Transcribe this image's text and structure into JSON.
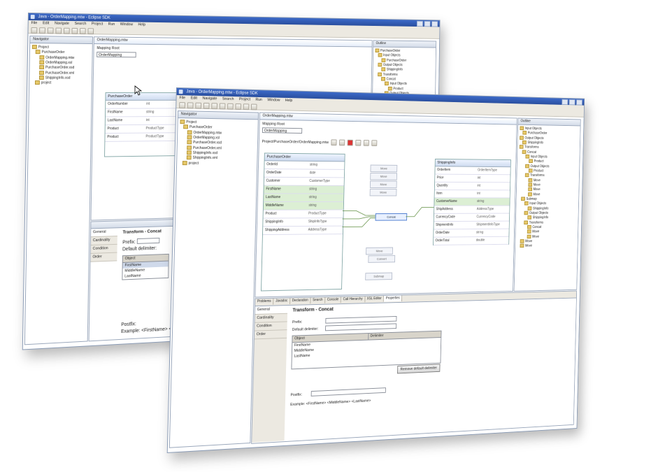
{
  "back_window": {
    "title": "Java - OrderMapping.mtw - Eclipse SDK",
    "menu": [
      "File",
      "Edit",
      "Navigate",
      "Search",
      "Project",
      "Run",
      "Window",
      "Help"
    ],
    "navigator_tab": "Navigator",
    "editor_tab": "OrderMapping.mtw",
    "outline_tab": "Outline",
    "mapping_root_label": "Mapping Root",
    "mapping_root_value": "OrderMapping",
    "tree": [
      {
        "level": 0,
        "label": "Project"
      },
      {
        "level": 1,
        "label": "PurchaseOrder"
      },
      {
        "level": 2,
        "label": "OrderMapping.mtw"
      },
      {
        "level": 2,
        "label": "OrderMapping.xsl"
      },
      {
        "level": 2,
        "label": "PurchaseOrder.xsd"
      },
      {
        "level": 2,
        "label": "PurchaseOrder.xml"
      },
      {
        "level": 2,
        "label": "ShippingInfo.xsd"
      },
      {
        "level": 1,
        "label": "project"
      }
    ],
    "outline": [
      {
        "level": 0,
        "label": "PurchaseOrder"
      },
      {
        "level": 1,
        "label": "Input Objects"
      },
      {
        "level": 2,
        "label": "PurchaseOrder"
      },
      {
        "level": 1,
        "label": "Output Objects"
      },
      {
        "level": 2,
        "label": "ShippingInfo"
      },
      {
        "level": 1,
        "label": "Transforms"
      },
      {
        "level": 2,
        "label": "Concat"
      },
      {
        "level": 3,
        "label": "Input Objects"
      },
      {
        "level": 4,
        "label": "Product"
      },
      {
        "level": 3,
        "label": "Output Objects"
      }
    ],
    "mapbox_title": "PurchaseOrder",
    "mapbox_rows": [
      {
        "name": "OrderNumber",
        "type": "int"
      },
      {
        "name": "FirstName",
        "type": "string"
      },
      {
        "name": "LastName",
        "type": "int"
      },
      {
        "name": "Product",
        "type": "ProductType"
      },
      {
        "name": "Product",
        "type": "ProductType"
      }
    ],
    "props_side": [
      "General",
      "Cardinality",
      "Condition",
      "Order"
    ],
    "props_title": "Transform - Concat",
    "prefix_label": "Prefix:",
    "default_delim_label": "Default delimiter:",
    "grid_header": "Object",
    "grid_rows": [
      "FirstName",
      "MiddleName",
      "LastName"
    ],
    "postfix_label": "Postfix:",
    "example_label": "Example: <FirstName> <"
  },
  "front_window": {
    "title": "Java - OrderMapping.mtw - Eclipse SDK",
    "menu": [
      "File",
      "Edit",
      "Navigate",
      "Search",
      "Project",
      "Run",
      "Window",
      "Help"
    ],
    "navigator_tab": "Navigator",
    "editor_tab": "OrderMapping.mtw",
    "outline_tab": "Outline",
    "mapping_root_label": "Mapping Root",
    "mapping_root_value": "OrderMapping",
    "mapping_path": "Project/PurchaseOrder/OrderMapping.mtw",
    "tree": [
      {
        "level": 0,
        "label": "Project"
      },
      {
        "level": 1,
        "label": "PurchaseOrder"
      },
      {
        "level": 2,
        "label": "OrderMapping.mtw"
      },
      {
        "level": 2,
        "label": "OrderMapping.xsl"
      },
      {
        "level": 2,
        "label": "PurchaseOrder.xsd"
      },
      {
        "level": 2,
        "label": "PurchaseOrder.xml"
      },
      {
        "level": 2,
        "label": "ShippingInfo.xsd"
      },
      {
        "level": 2,
        "label": "ShippingInfo.xml"
      },
      {
        "level": 1,
        "label": "project"
      }
    ],
    "outline": [
      {
        "level": 0,
        "label": "Input Objects"
      },
      {
        "level": 1,
        "label": "PurchaseOrder"
      },
      {
        "level": 0,
        "label": "Output Objects"
      },
      {
        "level": 1,
        "label": "ShippingInfo"
      },
      {
        "level": 0,
        "label": "Transforms"
      },
      {
        "level": 1,
        "label": "Concat"
      },
      {
        "level": 2,
        "label": "Input Objects"
      },
      {
        "level": 3,
        "label": "Product"
      },
      {
        "level": 2,
        "label": "Output Objects"
      },
      {
        "level": 3,
        "label": "Product"
      },
      {
        "level": 2,
        "label": "Transforms"
      },
      {
        "level": 3,
        "label": "Move"
      },
      {
        "level": 3,
        "label": "Move"
      },
      {
        "level": 3,
        "label": "Move"
      },
      {
        "level": 3,
        "label": "Move"
      },
      {
        "level": 1,
        "label": "Submap"
      },
      {
        "level": 2,
        "label": "Input Objects"
      },
      {
        "level": 3,
        "label": "ShippingInfo"
      },
      {
        "level": 2,
        "label": "Output Objects"
      },
      {
        "level": 3,
        "label": "ShippingInfo"
      },
      {
        "level": 2,
        "label": "Transforms"
      },
      {
        "level": 3,
        "label": "Concat"
      },
      {
        "level": 3,
        "label": "Move"
      },
      {
        "level": 3,
        "label": "Move"
      },
      {
        "level": 1,
        "label": "Move"
      },
      {
        "level": 1,
        "label": "Move"
      }
    ],
    "source_title": "PurchaseOrder",
    "source_rows": [
      {
        "name": "OrderId",
        "type": "string",
        "hl": false
      },
      {
        "name": "OrderDate",
        "type": "date",
        "hl": false
      },
      {
        "name": "Customer",
        "type": "CustomerType",
        "hl": false
      },
      {
        "name": "FirstName",
        "type": "string",
        "hl": true
      },
      {
        "name": "LastName",
        "type": "string",
        "hl": true
      },
      {
        "name": "MiddleName",
        "type": "string",
        "hl": true
      },
      {
        "name": "Product",
        "type": "ProductType",
        "hl": false
      },
      {
        "name": "ShippingInfo",
        "type": "ShipInfoType",
        "hl": false
      },
      {
        "name": "ShippingAddress",
        "type": "AddressType",
        "hl": false
      }
    ],
    "target_title": "ShippingInfo",
    "target_rows": [
      {
        "name": "OrderItem",
        "type": "OrderItemType",
        "hl": false
      },
      {
        "name": "Price",
        "type": "int",
        "hl": false
      },
      {
        "name": "Quantity",
        "type": "int",
        "hl": false
      },
      {
        "name": "Item",
        "type": "int",
        "hl": false
      },
      {
        "name": "CustomerName",
        "type": "string",
        "hl": true
      },
      {
        "name": "ShipAddress",
        "type": "AddressType",
        "hl": false
      },
      {
        "name": "CurrencyCode",
        "type": "CurrencyCode",
        "hl": false
      },
      {
        "name": "ShipmentInfo",
        "type": "ShipmentInfoType",
        "hl": false
      },
      {
        "name": "OrderDate",
        "type": "string",
        "hl": false
      },
      {
        "name": "OrderTotal",
        "type": "double",
        "hl": false
      }
    ],
    "transforms": [
      "Move",
      "Move",
      "Move",
      "Move",
      "Concat",
      "Move",
      "Convert",
      "Submap"
    ],
    "console_tabs": [
      "Problems",
      "Javadoc",
      "Declaration",
      "Search",
      "Console",
      "Call Hierarchy",
      "XSL Editor",
      "Properties"
    ],
    "props_side": [
      "General",
      "Cardinality",
      "Condition",
      "Order"
    ],
    "props_title": "Transform - Concat",
    "prefix_label": "Prefix:",
    "default_delim_label": "Default delimiter:",
    "grid_headers": [
      "Object",
      "Delimiter"
    ],
    "grid_rows": [
      "FirstName",
      "MiddleName",
      "LastName"
    ],
    "remove_delim_button": "Remove default delimiter",
    "postfix_label": "Postfix:",
    "example_label": "Example: <FirstName> <MiddleName> <LastName>"
  },
  "colors": {
    "titlebar": "#2a4f9f",
    "highlight_row": "#dcefd4",
    "link_line": "#5a8a3a",
    "selected_node": "#4b7bd0"
  }
}
